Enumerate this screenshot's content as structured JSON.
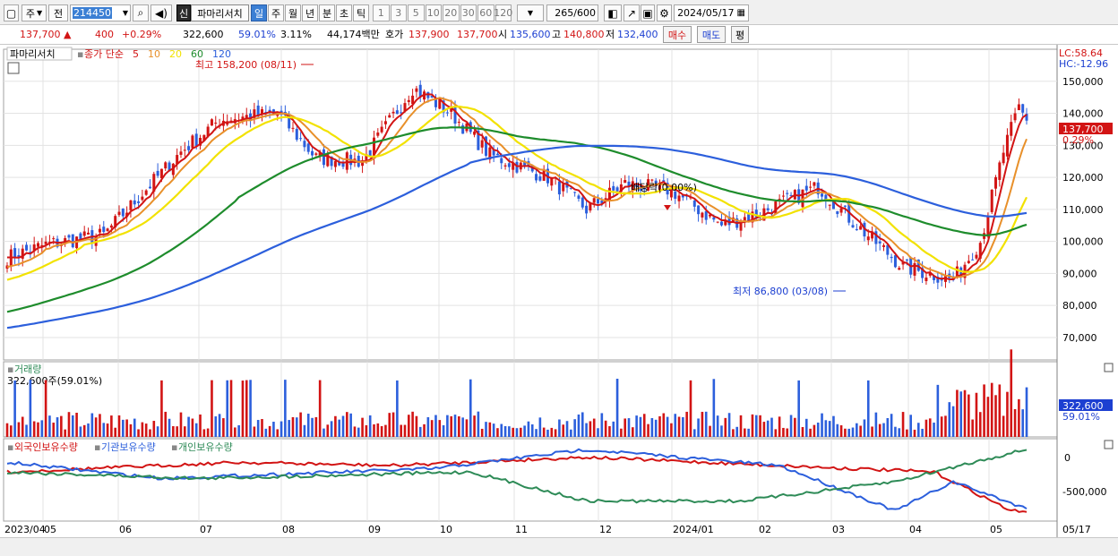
{
  "toolbar": {
    "market": "주",
    "type": "전",
    "code": "214450",
    "stock_name": "파마리서치",
    "periods": [
      "일",
      "주",
      "월",
      "년",
      "분",
      "초",
      "틱"
    ],
    "selected_period": "일",
    "minute_values": [
      "1",
      "3",
      "5",
      "10",
      "20",
      "30",
      "60",
      "120"
    ],
    "count": "265",
    "count_total": "/600",
    "date": "2024/05/17",
    "badge": "신"
  },
  "quote": {
    "price": "137,700",
    "change_arrow": "▲",
    "change": "400",
    "change_pct": "+0.29%",
    "volume": "322,600",
    "volume_pct": "59.01%",
    "turnover": "3.11%",
    "amount": "44,174백만",
    "hoga_label": "호가",
    "ask": "137,900",
    "bid": "137,700",
    "open_label": "시",
    "open": "135,600",
    "high_label": "고",
    "high": "140,800",
    "low_label": "저",
    "low": "132,400",
    "buy_label": "매수",
    "sell_label": "매도",
    "eval_label": "평"
  },
  "price_panel": {
    "title": "파마리서치",
    "legend_prefix": "종가 단순",
    "ma_labels": [
      "5",
      "10",
      "20",
      "60",
      "120"
    ],
    "ma_colors": [
      "#d21414",
      "#e8902a",
      "#f2e200",
      "#1e8c2c",
      "#2c5fdc"
    ],
    "lc": "LC:58.64",
    "hc": "HC:-12.96",
    "current_price_tag": "137,700",
    "current_pct_tag": "0.29%",
    "high_annotation": "최고 158,200 (08/11)",
    "low_annotation": "최저 86,800 (03/08)",
    "dividend_annotation": "배당락(0.00%)",
    "y_ticks": [
      "150,000",
      "140,000",
      "130,000",
      "120,000",
      "110,000",
      "100,000",
      "90,000",
      "80,000",
      "70,000"
    ]
  },
  "volume_panel": {
    "title": "거래량",
    "value": "322,600주(59.01%)",
    "tag_value": "322,600",
    "tag_pct": "59.01%"
  },
  "holding_panel": {
    "legend": [
      "외국인보유수량",
      "기관보유수량",
      "개인보유수량"
    ],
    "colors": [
      "#d21414",
      "#2c5fdc",
      "#2e8b57"
    ],
    "y_ticks": [
      "0",
      "-500,000"
    ]
  },
  "x_axis": {
    "labels": [
      "2023/04",
      "05",
      "06",
      "07",
      "08",
      "09",
      "10",
      "11",
      "12",
      "2024/01",
      "02",
      "03",
      "04",
      "05",
      "05/17"
    ]
  }
}
